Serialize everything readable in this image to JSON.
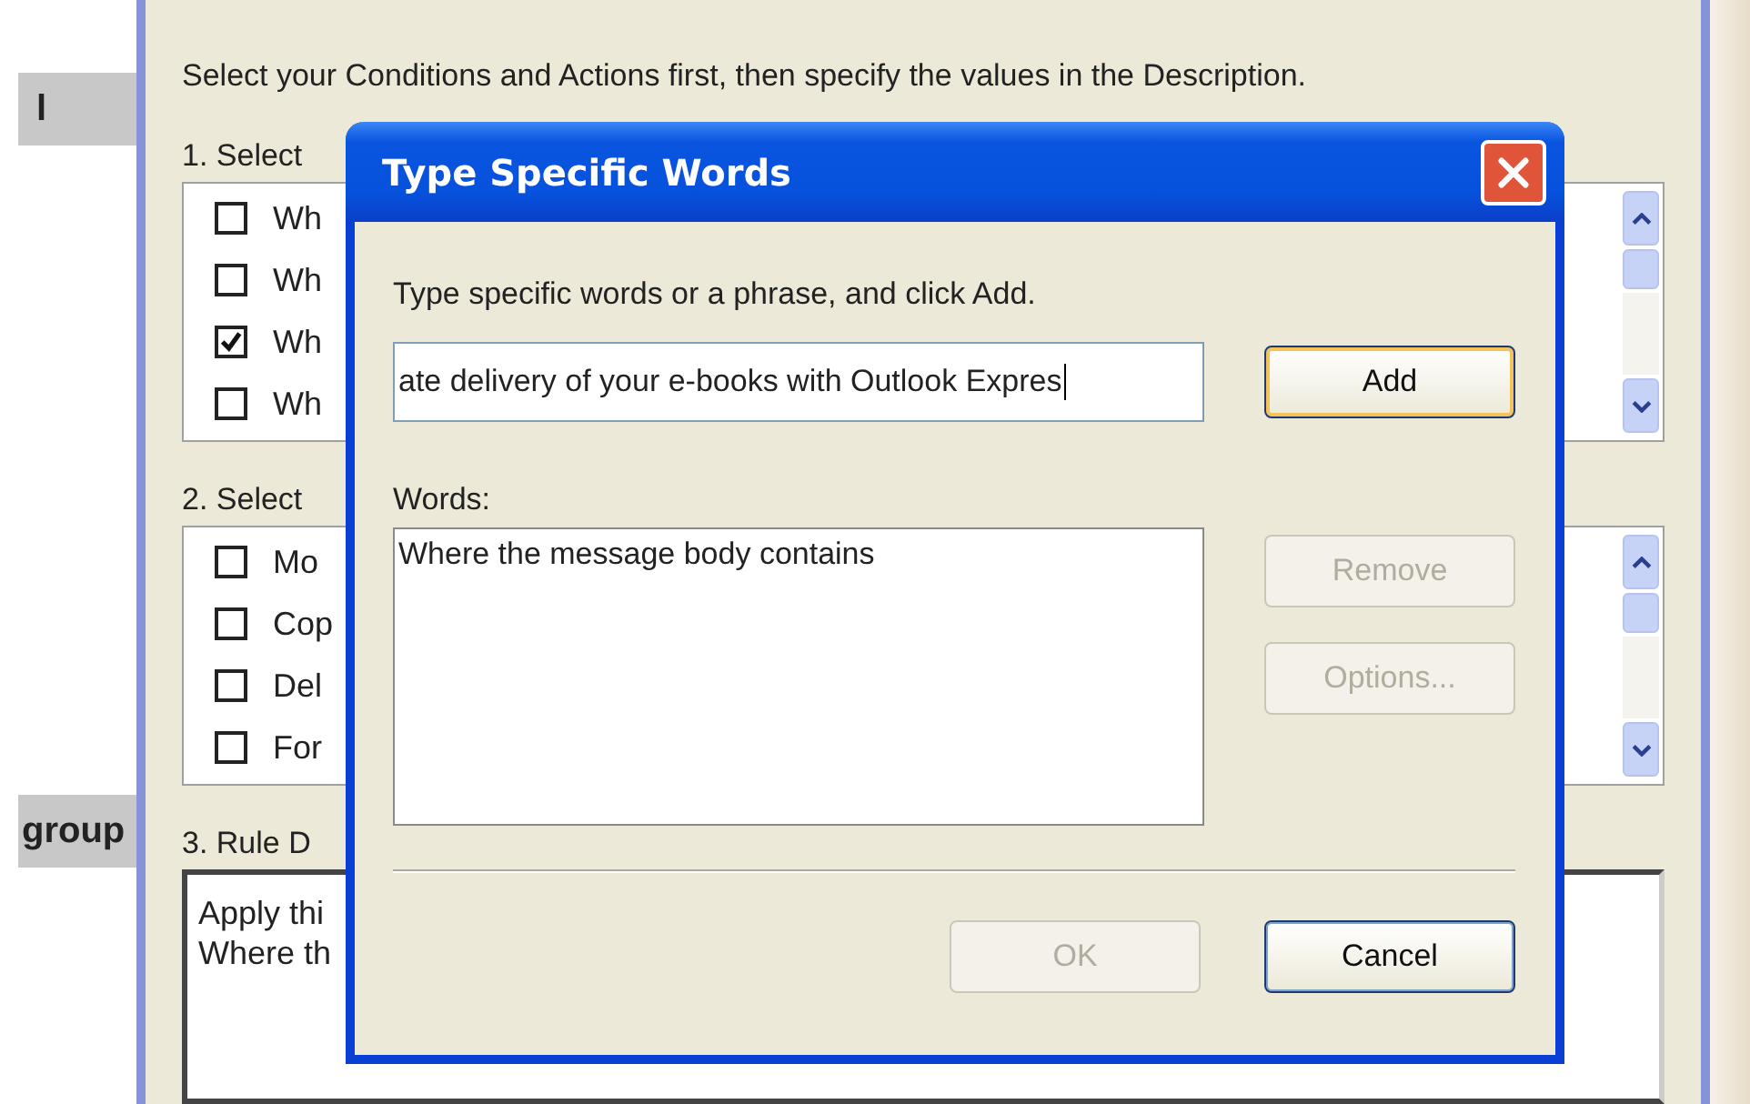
{
  "side_labels": [
    "l",
    "group"
  ],
  "rules_window": {
    "instruction": "Select your Conditions and Actions first, then specify the values in the Description.",
    "conditions_label": "1. Select",
    "conditions": [
      {
        "label": "Wh",
        "checked": false
      },
      {
        "label": "Wh",
        "checked": false
      },
      {
        "label": "Wh",
        "checked": true
      },
      {
        "label": "Wh",
        "checked": false
      }
    ],
    "actions_label": "2. Select",
    "actions": [
      {
        "label": "Mo",
        "checked": false
      },
      {
        "label": "Cop",
        "checked": false
      },
      {
        "label": "Del",
        "checked": false
      },
      {
        "label": "For",
        "checked": false
      }
    ],
    "description_label": "3. Rule D",
    "description_lines": [
      "Apply thi",
      "Where th"
    ]
  },
  "dialog": {
    "title": "Type Specific Words",
    "prompt": "Type specific words or a phrase, and click Add.",
    "input_value": "ate delivery of your e-books with Outlook Expres",
    "words_label": "Words:",
    "words": [
      "Where the message body contains"
    ],
    "buttons": [
      {
        "label": "Add",
        "disabled": false,
        "focused": true
      },
      {
        "label": "Remove",
        "disabled": true,
        "focused": false
      },
      {
        "label": "Options...",
        "disabled": true,
        "focused": false
      }
    ],
    "footer_buttons": [
      {
        "label": "OK",
        "disabled": true,
        "focused": false
      },
      {
        "label": "Cancel",
        "disabled": false,
        "focused": true
      }
    ]
  }
}
